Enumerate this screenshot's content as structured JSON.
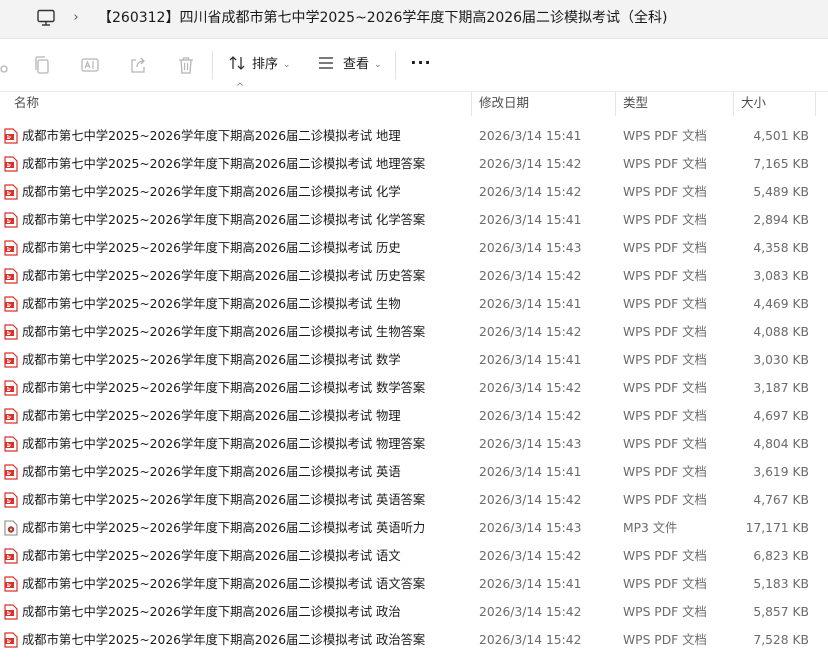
{
  "address": {
    "separator": "›",
    "path": "【260312】四川省成都市第七中学2025~2026学年度下期高2026届二诊模拟考试（全科)"
  },
  "toolbar": {
    "sort_label": "排序",
    "view_label": "查看",
    "more_label": "···",
    "chevron": "⌄"
  },
  "columns": {
    "name": "名称",
    "modified": "修改日期",
    "type": "类型",
    "size": "大小"
  },
  "sort_indicator": "^",
  "colors": {
    "pdf_icon": "#d9322b",
    "mp3_icon": "#b23a2e",
    "toolbar_disabled": "#b5b5b5"
  },
  "files": [
    {
      "name": "成都市第七中学2025~2026学年度下期高2026届二诊模拟考试 地理",
      "modified": "2026/3/14 15:41",
      "type": "WPS PDF 文档",
      "size": "4,501 KB",
      "icon": "pdf-icon"
    },
    {
      "name": "成都市第七中学2025~2026学年度下期高2026届二诊模拟考试 地理答案",
      "modified": "2026/3/14 15:42",
      "type": "WPS PDF 文档",
      "size": "7,165 KB",
      "icon": "pdf-icon"
    },
    {
      "name": "成都市第七中学2025~2026学年度下期高2026届二诊模拟考试 化学",
      "modified": "2026/3/14 15:42",
      "type": "WPS PDF 文档",
      "size": "5,489 KB",
      "icon": "pdf-icon"
    },
    {
      "name": "成都市第七中学2025~2026学年度下期高2026届二诊模拟考试 化学答案",
      "modified": "2026/3/14 15:41",
      "type": "WPS PDF 文档",
      "size": "2,894 KB",
      "icon": "pdf-icon"
    },
    {
      "name": "成都市第七中学2025~2026学年度下期高2026届二诊模拟考试 历史",
      "modified": "2026/3/14 15:43",
      "type": "WPS PDF 文档",
      "size": "4,358 KB",
      "icon": "pdf-icon"
    },
    {
      "name": "成都市第七中学2025~2026学年度下期高2026届二诊模拟考试 历史答案",
      "modified": "2026/3/14 15:42",
      "type": "WPS PDF 文档",
      "size": "3,083 KB",
      "icon": "pdf-icon"
    },
    {
      "name": "成都市第七中学2025~2026学年度下期高2026届二诊模拟考试 生物",
      "modified": "2026/3/14 15:41",
      "type": "WPS PDF 文档",
      "size": "4,469 KB",
      "icon": "pdf-icon"
    },
    {
      "name": "成都市第七中学2025~2026学年度下期高2026届二诊模拟考试 生物答案",
      "modified": "2026/3/14 15:42",
      "type": "WPS PDF 文档",
      "size": "4,088 KB",
      "icon": "pdf-icon"
    },
    {
      "name": "成都市第七中学2025~2026学年度下期高2026届二诊模拟考试 数学",
      "modified": "2026/3/14 15:41",
      "type": "WPS PDF 文档",
      "size": "3,030 KB",
      "icon": "pdf-icon"
    },
    {
      "name": "成都市第七中学2025~2026学年度下期高2026届二诊模拟考试 数学答案",
      "modified": "2026/3/14 15:42",
      "type": "WPS PDF 文档",
      "size": "3,187 KB",
      "icon": "pdf-icon"
    },
    {
      "name": "成都市第七中学2025~2026学年度下期高2026届二诊模拟考试 物理",
      "modified": "2026/3/14 15:42",
      "type": "WPS PDF 文档",
      "size": "4,697 KB",
      "icon": "pdf-icon"
    },
    {
      "name": "成都市第七中学2025~2026学年度下期高2026届二诊模拟考试 物理答案",
      "modified": "2026/3/14 15:43",
      "type": "WPS PDF 文档",
      "size": "4,804 KB",
      "icon": "pdf-icon"
    },
    {
      "name": "成都市第七中学2025~2026学年度下期高2026届二诊模拟考试 英语",
      "modified": "2026/3/14 15:41",
      "type": "WPS PDF 文档",
      "size": "3,619 KB",
      "icon": "pdf-icon"
    },
    {
      "name": "成都市第七中学2025~2026学年度下期高2026届二诊模拟考试 英语答案",
      "modified": "2026/3/14 15:42",
      "type": "WPS PDF 文档",
      "size": "4,767 KB",
      "icon": "pdf-icon"
    },
    {
      "name": "成都市第七中学2025~2026学年度下期高2026届二诊模拟考试 英语听力",
      "modified": "2026/3/14 15:43",
      "type": "MP3 文件",
      "size": "17,171 KB",
      "icon": "mp3-icon"
    },
    {
      "name": "成都市第七中学2025~2026学年度下期高2026届二诊模拟考试 语文",
      "modified": "2026/3/14 15:42",
      "type": "WPS PDF 文档",
      "size": "6,823 KB",
      "icon": "pdf-icon"
    },
    {
      "name": "成都市第七中学2025~2026学年度下期高2026届二诊模拟考试 语文答案",
      "modified": "2026/3/14 15:41",
      "type": "WPS PDF 文档",
      "size": "5,183 KB",
      "icon": "pdf-icon"
    },
    {
      "name": "成都市第七中学2025~2026学年度下期高2026届二诊模拟考试 政治",
      "modified": "2026/3/14 15:42",
      "type": "WPS PDF 文档",
      "size": "5,857 KB",
      "icon": "pdf-icon"
    },
    {
      "name": "成都市第七中学2025~2026学年度下期高2026届二诊模拟考试 政治答案",
      "modified": "2026/3/14 15:42",
      "type": "WPS PDF 文档",
      "size": "7,528 KB",
      "icon": "pdf-icon"
    }
  ]
}
